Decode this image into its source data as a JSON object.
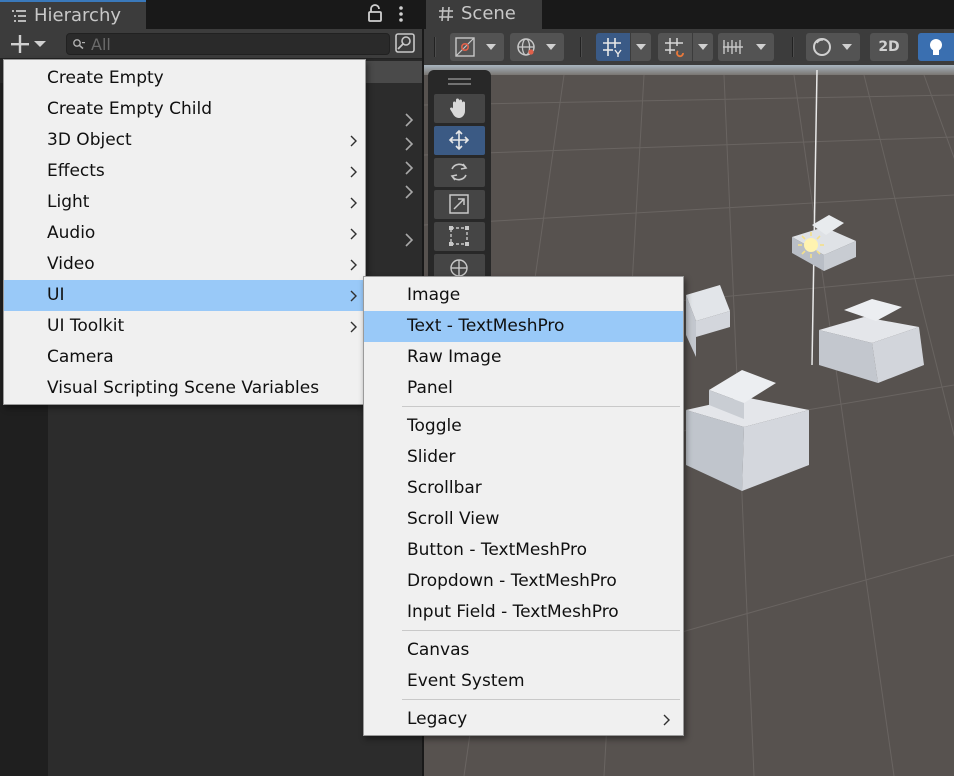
{
  "hierarchy": {
    "tab_label": "Hierarchy",
    "tab_icon": "list-icon",
    "search_placeholder": "All"
  },
  "scene": {
    "tab_label": "Scene",
    "tab_icon": "hash-icon",
    "toolbar_2d_label": "2D"
  },
  "context_menu": {
    "items": [
      {
        "label": "Create Empty",
        "submenu": false
      },
      {
        "label": "Create Empty Child",
        "submenu": false
      },
      {
        "label": "3D Object",
        "submenu": true
      },
      {
        "label": "Effects",
        "submenu": true
      },
      {
        "label": "Light",
        "submenu": true
      },
      {
        "label": "Audio",
        "submenu": true
      },
      {
        "label": "Video",
        "submenu": true
      },
      {
        "label": "UI",
        "submenu": true,
        "highlighted": true
      },
      {
        "label": "UI Toolkit",
        "submenu": true
      },
      {
        "label": "Camera",
        "submenu": false
      },
      {
        "label": "Visual Scripting Scene Variables",
        "submenu": false
      }
    ]
  },
  "ui_submenu": {
    "items": [
      {
        "label": "Image"
      },
      {
        "label": "Text - TextMeshPro",
        "highlighted": true
      },
      {
        "label": "Raw Image"
      },
      {
        "label": "Panel"
      },
      {
        "label": "Toggle"
      },
      {
        "label": "Slider"
      },
      {
        "label": "Scrollbar"
      },
      {
        "label": "Scroll View"
      },
      {
        "label": "Button - TextMeshPro"
      },
      {
        "label": "Dropdown - TextMeshPro"
      },
      {
        "label": "Input Field - TextMeshPro"
      },
      {
        "label": "Canvas"
      },
      {
        "label": "Event System"
      },
      {
        "label": "Legacy",
        "submenu": true
      }
    ]
  },
  "colors": {
    "highlight": "#99c9f8",
    "accent_blue": "#3a79bb",
    "menu_bg": "#f0f0f0"
  }
}
